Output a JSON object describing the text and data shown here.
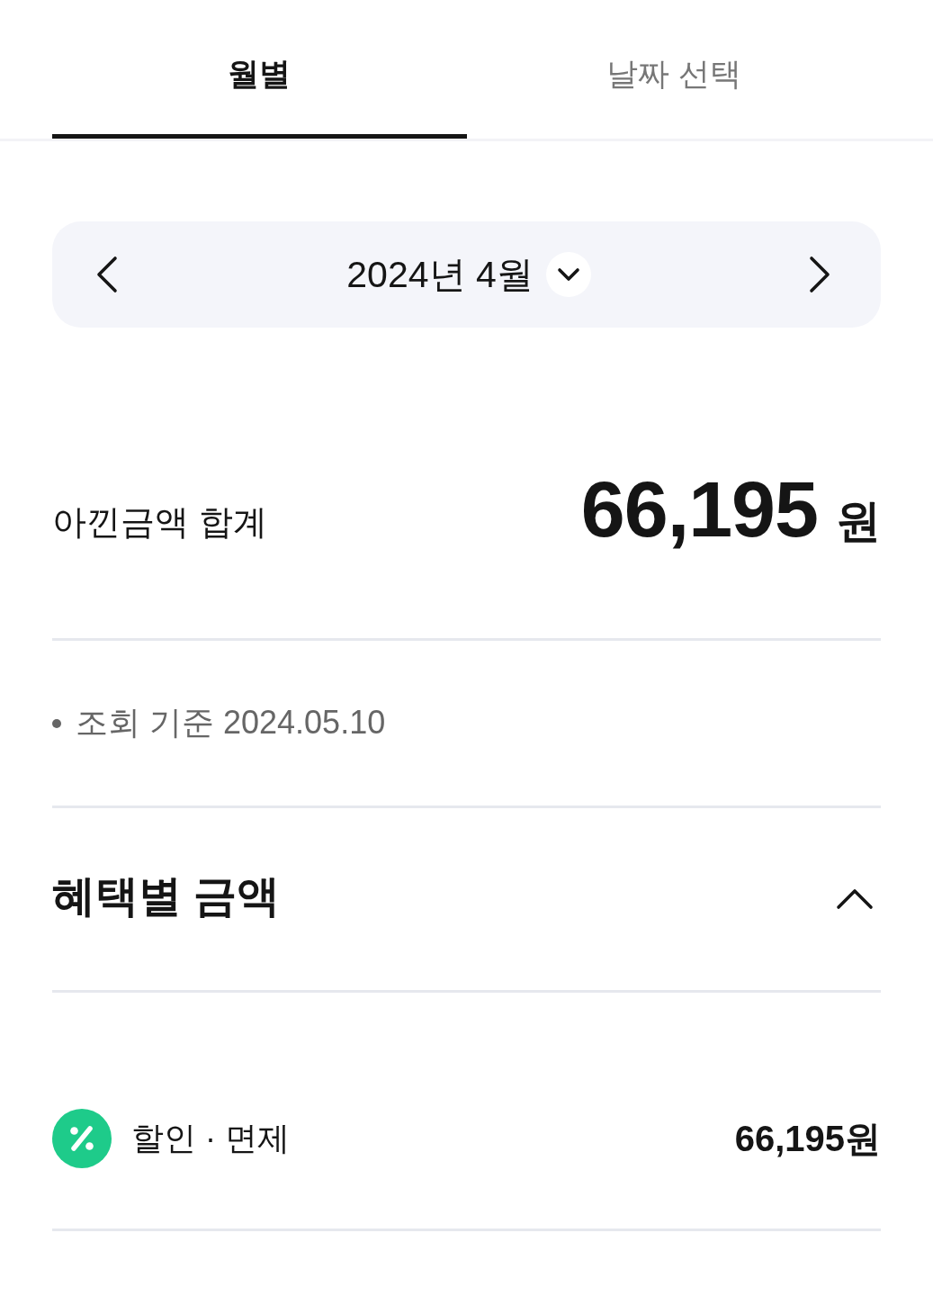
{
  "tabs": [
    {
      "label": "월별",
      "selected": true
    },
    {
      "label": "날짜 선택",
      "selected": false
    }
  ],
  "month_selector": {
    "label": "2024년 4월"
  },
  "total": {
    "label": "아낀금액 합계",
    "amount": "66,195",
    "unit": "원"
  },
  "note": {
    "text": "조회 기준 2024.05.10"
  },
  "section": {
    "title": "혜택별 금액",
    "expanded": true
  },
  "items": [
    {
      "label": "할인 · 면제",
      "amount": "66,195원"
    }
  ]
}
